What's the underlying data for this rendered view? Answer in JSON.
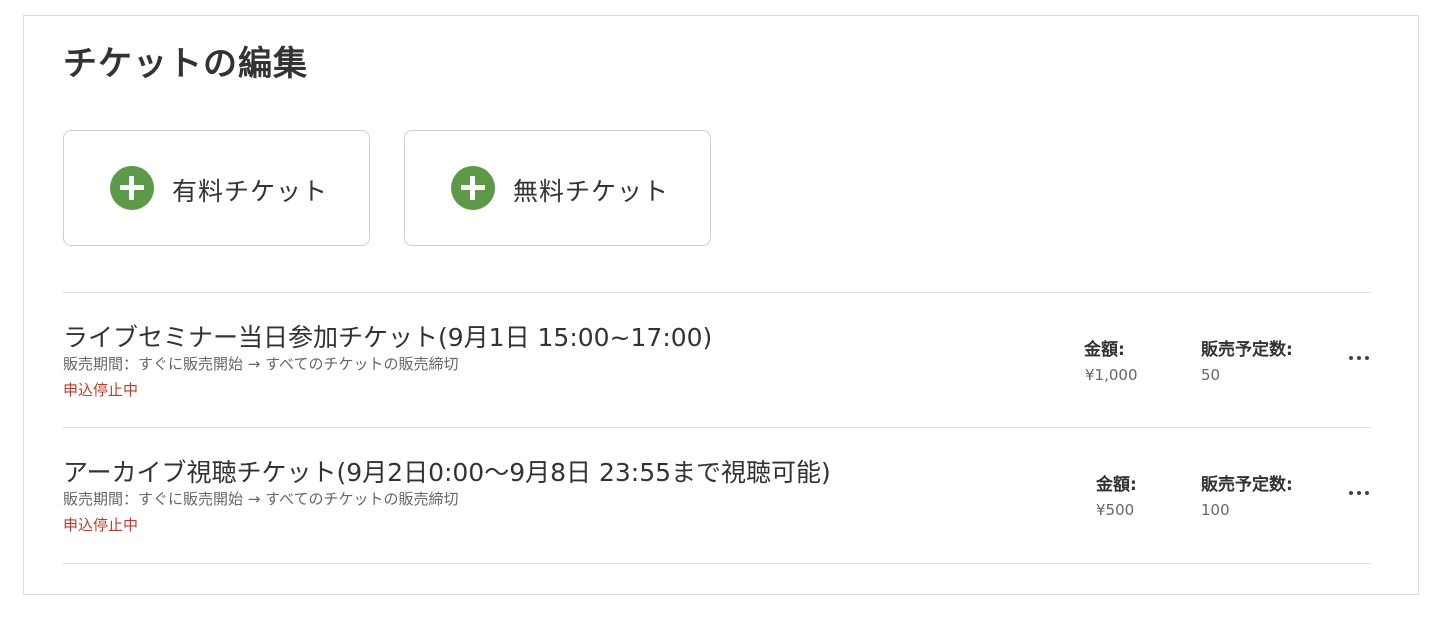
{
  "page": {
    "title": "チケットの編集"
  },
  "add_buttons": {
    "paid": {
      "label": "有料チケット",
      "icon": "plus-circle-icon"
    },
    "free": {
      "label": "無料チケット",
      "icon": "plus-circle-icon"
    }
  },
  "tickets": [
    {
      "name": "ライブセミナー当日参加チケット(9月1日 15:00~17:00)",
      "period": "販売期間：すぐに販売開始 → すべてのチケットの販売締切",
      "status": "申込停止中",
      "price_label": "金額:",
      "price": "¥1,000",
      "planned_label": "販売予定数:",
      "planned": "50"
    },
    {
      "name": "アーカイブ視聴チケット(9月2日0:00〜9月8日 23:55まで視聴可能)",
      "period": "販売期間：すぐに販売開始 → すべてのチケットの販売締切",
      "status": "申込停止中",
      "price_label": "金額:",
      "price": "¥500",
      "planned_label": "販売予定数:",
      "planned": "100"
    }
  ],
  "colors": {
    "accent_green": "#5d9a48",
    "status_red": "#c0392b",
    "border": "#dcdcdc"
  }
}
